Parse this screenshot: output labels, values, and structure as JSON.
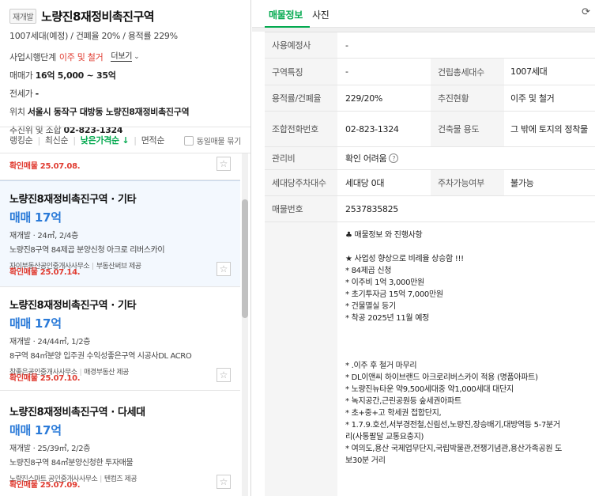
{
  "complex": {
    "badge": "재개발",
    "title": "노량진8재정비촉진구역",
    "meta": "1007세대(예정) / 건폐율 20% / 용적률 229%",
    "stage_label": "사업시행단계",
    "stage_value": "이주 및 철거",
    "more_label": "더보기",
    "sale_price_label": "매매가",
    "sale_price_value": "16억 5,000 ~ 35억",
    "jeonse_label": "전세가",
    "jeonse_value": "-",
    "location_label": "위치",
    "location_value": "서울시 동작구 대방동 노량진8재정비촉진구역",
    "contact_label": "추진위 및 조합",
    "contact_value": "02-823-1324"
  },
  "sort": {
    "items": [
      "랭킹순",
      "최신순",
      "낮은가격순 ↓",
      "면적순"
    ],
    "same_listing": "동일매물 묶기"
  },
  "listings": [
    {
      "confirm": "확인매물 25.07.08."
    },
    {
      "title": "노량진8재정비촉진구역 · 기타",
      "price": "매매 17억",
      "spec": "재개발 · 24㎡, 2/4층",
      "desc": "노량진8구역 84제곱 분양신청 아크로 리버스카이",
      "agent": "자이부동산공인중개사사무소",
      "provider": "부동산써브 제공",
      "confirm": "확인매물 25.07.14."
    },
    {
      "title": "노량진8재정비촉진구역 · 기타",
      "price": "매매 17억",
      "spec": "재개발 · 24/44㎡, 1/2층",
      "desc": "8구역 84㎡분양 입주권 수익성좋은구역 시공사DL ACRO",
      "agent": "참좋은공인중개사사무소",
      "provider": "매경부동산 제공",
      "confirm": "확인매물 25.07.10."
    },
    {
      "title": "노량진8재정비촉진구역 · 다세대",
      "price": "매매 17억",
      "spec": "재개발 · 25/39㎡, 2/2층",
      "desc": "노량진8구역 84㎡분양신청한 투자매물",
      "agent": "노량진스마트 공인중개사사무소",
      "provider": "텐컴즈 제공",
      "confirm": "확인매물 25.07.09."
    }
  ],
  "tabs": [
    "매물정보",
    "사진"
  ],
  "details": {
    "rows": [
      {
        "label": "사용예정사",
        "value": "-"
      },
      {
        "label": "구역특징",
        "value": "-",
        "label2": "건립총세대수",
        "value2": "1007세대"
      },
      {
        "label": "용적률/건폐율",
        "value": "229/20%",
        "label2": "추진현황",
        "value2": "이주 및 철거"
      },
      {
        "label": "조합전화번호",
        "value": "02-823-1324",
        "label2": "건축물 용도",
        "value2": "그 밖에 토지의 정착물"
      },
      {
        "label": "관리비",
        "value": "확인 어려움"
      },
      {
        "label": "세대당주차대수",
        "value": "세대당 0대",
        "label2": "주차가능여부",
        "value2": "불가능"
      },
      {
        "label": "매물번호",
        "value": "2537835825"
      }
    ],
    "description": [
      "♣ 매물정보 와 진행사항",
      "",
      "★ 사업성 향상으로 비례율 상승함 !!!",
      "* 84제곱 신청",
      "* 이주비 1억 3,000만원",
      "* 초기투자금 15억 7,000만원",
      "* 건물멸실 등기",
      "* 착공 2025년 11월 예정",
      "",
      "",
      "",
      "* .이주 후 철거 마무리",
      "* DL이앤씨 하이브랜드 아크로리버스카이 적용 (명품아파트)",
      "* 노량진뉴타운 약9,500세대중 약1,000세대 대단지",
      "* 녹지공간,근린공원등 숲세권아파트",
      "* 초+중+고 학세권 접합단지,",
      "* 1.7.9.호선,서부경전철,신림선,노량진,장승배기,대방역등 5-7분거",
      "리(사통팔달 교통요충지)",
      "* 여의도,용산 국제업무단지,국립박물관,전쟁기념관,용산가족공원 도",
      "보30분 거리"
    ]
  },
  "colors": {
    "accent": "#03a94f",
    "price": "#2a7ad8",
    "alert": "#e03c31"
  },
  "icons": {
    "favorite": "star-icon",
    "refresh": "refresh-icon"
  }
}
